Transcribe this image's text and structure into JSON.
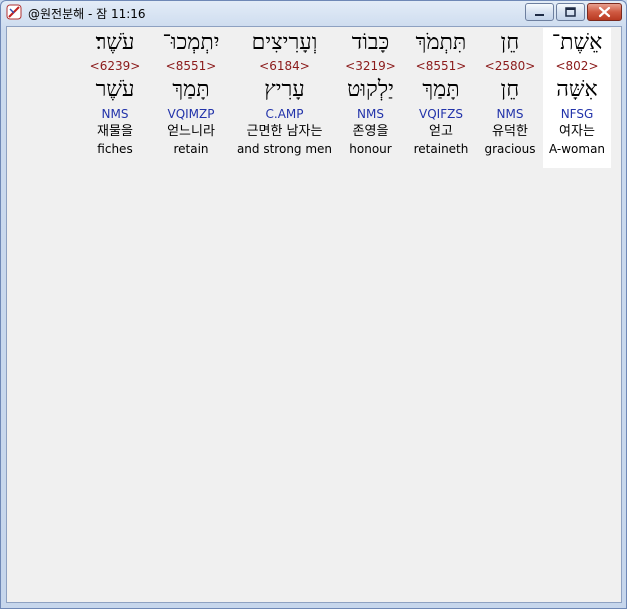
{
  "window": {
    "title": "@원전분해 - 잠 11:16"
  },
  "words": [
    {
      "hebrew": "אֵשֶׁת־",
      "strongs": "<802>",
      "lemma": "אִשָּׁה",
      "parsing": "NFSG",
      "korean": "여자는",
      "english": "A-woman",
      "selected": true
    },
    {
      "hebrew": "חֵן",
      "strongs": "<2580>",
      "lemma": "חֵן",
      "parsing": "NMS",
      "korean": "유덕한",
      "english": "gracious",
      "selected": false
    },
    {
      "hebrew": "תִּתְמֹךְ",
      "strongs": "<8551>",
      "lemma": "תָּמַךְ",
      "parsing": "VQIFZS",
      "korean": "얻고",
      "english": "retaineth",
      "selected": false
    },
    {
      "hebrew": "כָּבוֹד",
      "strongs": "<3219>",
      "lemma": "יַלְקוּט",
      "parsing": "NMS",
      "korean": "존영을",
      "english": "honour",
      "selected": false
    },
    {
      "hebrew": "וְעָרִיצִים",
      "strongs": "<6184>",
      "lemma": "עָרִיץ",
      "parsing": "C.AMP",
      "korean": "근면한 남자는",
      "english": "and strong men",
      "selected": false
    },
    {
      "hebrew": "יִתְמְכוּ־",
      "strongs": "<8551>",
      "lemma": "תָּמַךְ",
      "parsing": "VQIMZP",
      "korean": "얻느니라",
      "english": "retain",
      "selected": false
    },
    {
      "hebrew": "עֹשֶׁר׃",
      "strongs": "<6239>",
      "lemma": "עֹשֶׁר",
      "parsing": "NMS",
      "korean": "재물을",
      "english": "fiches",
      "selected": false
    }
  ]
}
